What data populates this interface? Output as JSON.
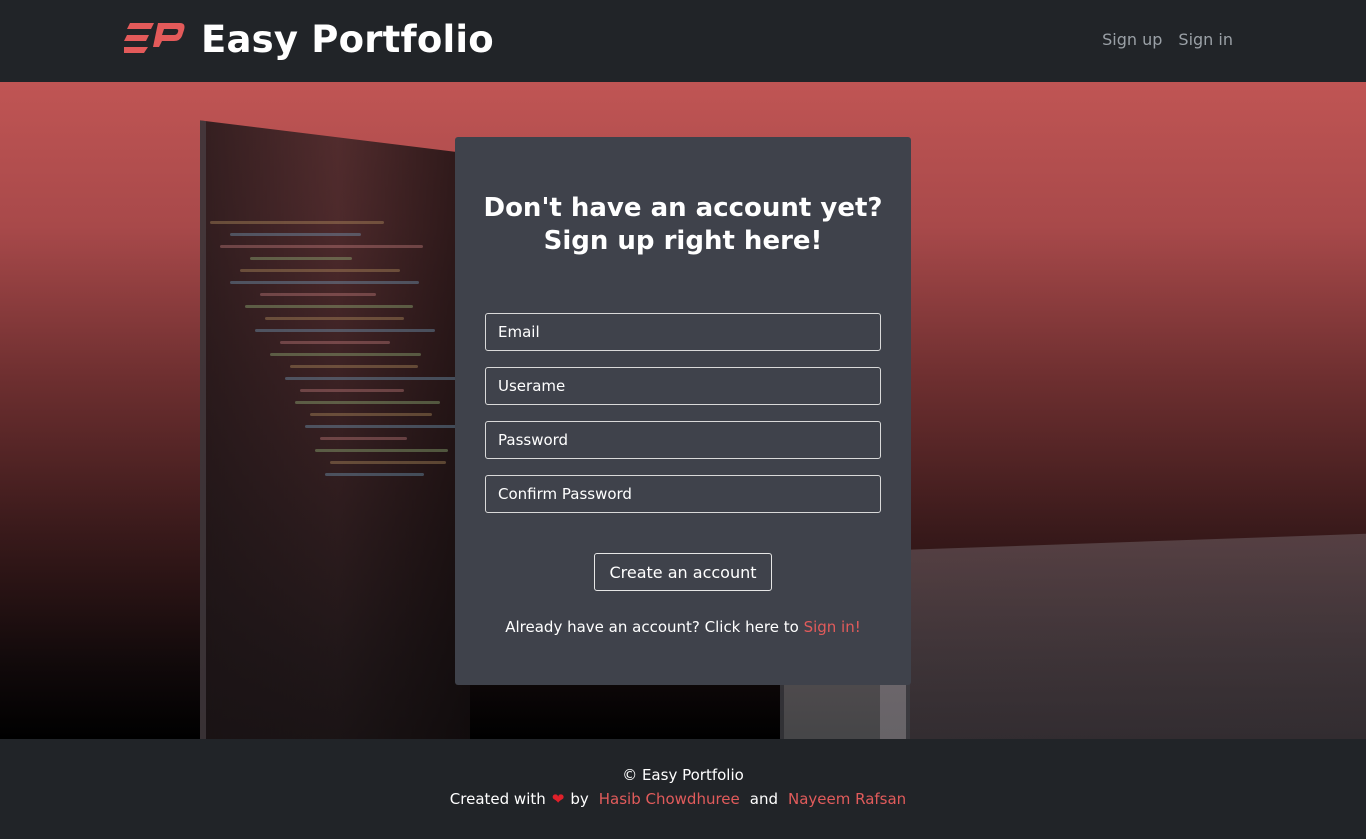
{
  "navbar": {
    "brand_name": "Easy Portfolio",
    "logo_icon": "ep-logo-icon",
    "links": [
      {
        "label": "Sign up"
      },
      {
        "label": "Sign in"
      }
    ]
  },
  "signup_card": {
    "title_line1": "Don't have an account yet?",
    "title_line2": "Sign up right here!",
    "fields": {
      "email_placeholder": "Email",
      "username_placeholder": "Userame",
      "password_placeholder": "Password",
      "confirm_placeholder": "Confirm Password"
    },
    "submit_label": "Create an account",
    "signin_prompt": "Already have an account? Click here to",
    "signin_link": "Sign in!"
  },
  "footer": {
    "copyright": "© Easy Portfolio",
    "created_with": "Created with",
    "heart_icon": "heart-icon",
    "by": "by",
    "author1": "Hasib Chowdhuree",
    "and": "and",
    "author2": "Nayeem Rafsan"
  },
  "colors": {
    "accent": "#e15b5b",
    "navbar_bg": "#212428",
    "card_bg": "#3f424b"
  }
}
